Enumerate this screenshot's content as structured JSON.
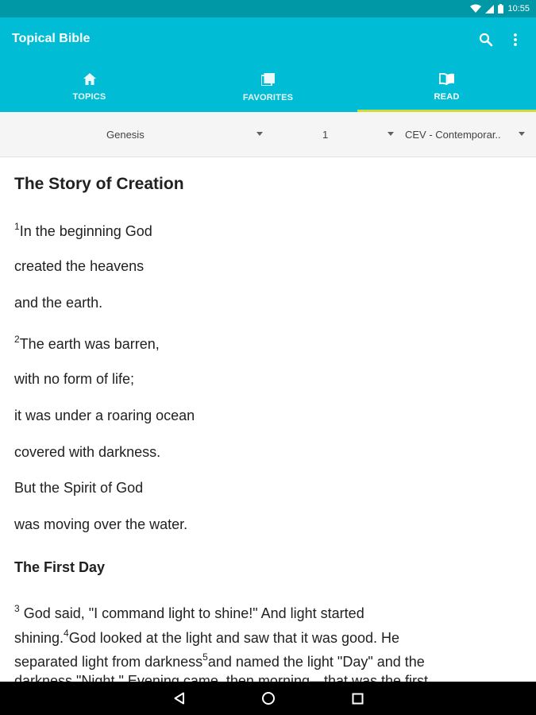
{
  "status_bar": {
    "time": "10:55"
  },
  "app_bar": {
    "title": "Topical Bible",
    "tabs": [
      {
        "label": "TOPICS",
        "icon": "home-icon"
      },
      {
        "label": "FAVORITES",
        "icon": "favorites-icon"
      },
      {
        "label": "READ",
        "icon": "book-icon",
        "selected": true
      }
    ]
  },
  "selectors": {
    "book": "Genesis",
    "chapter": "1",
    "translation": "CEV - Contemporar.."
  },
  "content": {
    "chapter_title": "The Story of Creation",
    "verses": [
      {
        "num": "1",
        "text": "In the beginning God"
      },
      {
        "text": "created the heavens"
      },
      {
        "text": "and the earth."
      },
      {
        "num": "2",
        "text": "The earth was barren,"
      },
      {
        "text": "with no form of life;"
      },
      {
        "text": "it was under a roaring ocean"
      },
      {
        "text": "covered with darkness."
      },
      {
        "text": "But the Spirit of God"
      },
      {
        "text": "was moving over the water."
      }
    ],
    "section_heading": "The First Day",
    "paragraph": {
      "line1_num": "3",
      "line1": " God said, \"I command light to shine!\" And light started",
      "line2a": "shining.",
      "line2_num": "4",
      "line2b": "God looked at the light and saw that it was good. He",
      "line3a": "separated light from darkness",
      "line3_num": "5",
      "line3b": "and named the light \"Day\" and the",
      "line4": "darkness \"Night.\" Evening came, then morning—that was the first"
    }
  },
  "colors": {
    "primary": "#00bcd4",
    "primary_dark": "#0097a7",
    "tab_indicator": "#cddc39"
  }
}
